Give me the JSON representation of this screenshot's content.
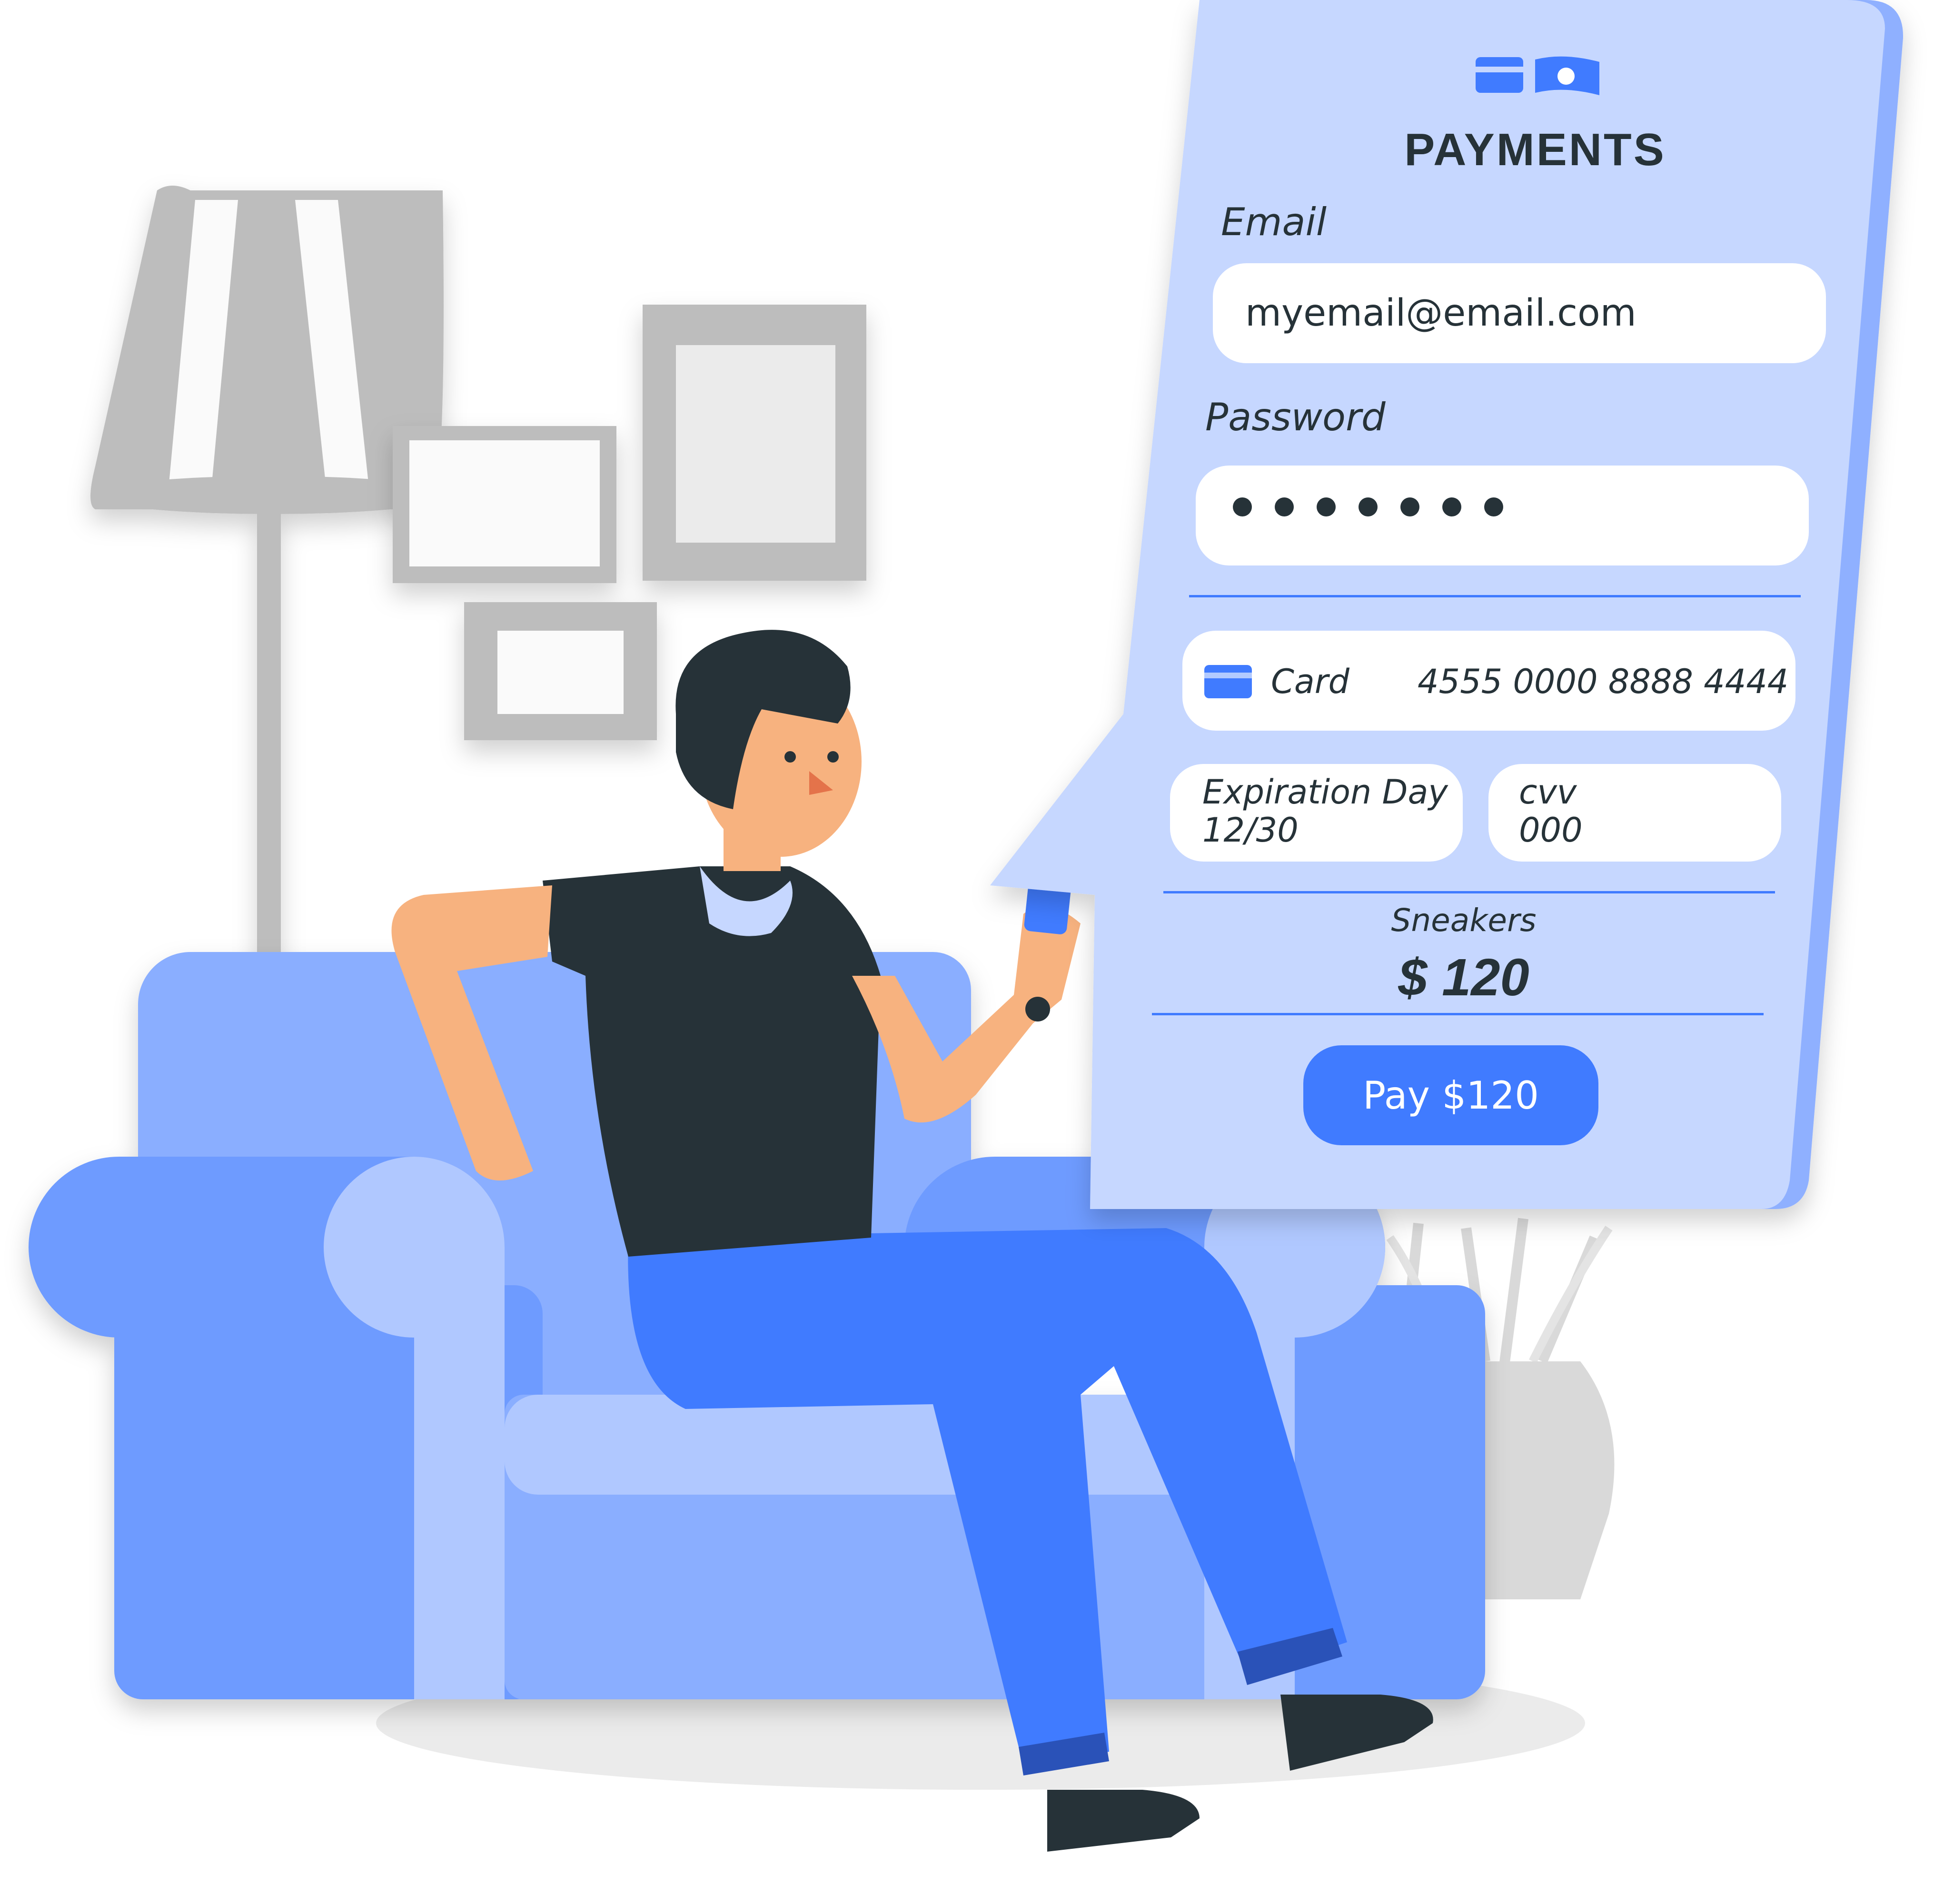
{
  "payments": {
    "title": "PAYMENTS",
    "icon": "card-and-cash-icon",
    "email": {
      "label": "Email",
      "value": "myemail@email.com"
    },
    "password": {
      "label": "Password",
      "masked_length": 7
    },
    "card": {
      "label": "Card",
      "icon": "credit-card-icon",
      "number": "4555 0000 8888 4444"
    },
    "expiration": {
      "label": "Expiration Day",
      "value": "12/30"
    },
    "cvv": {
      "label": "cvv",
      "value": "000"
    },
    "product": {
      "name": "Sneakers",
      "price": "$ 120"
    },
    "pay_button": {
      "label": "Pay $120"
    }
  },
  "colors": {
    "panel": "#c6d7ff",
    "panel_edge": "#8fb0ff",
    "accent": "#407bff",
    "dark": "#263238",
    "skin": "#f7b27f",
    "sofa_light": "#b0c8ff",
    "sofa_mid": "#8aaeff",
    "sofa_dark": "#6e9bff",
    "gray": "#bdbdbd",
    "gray_light": "#ebebeb"
  },
  "illustration": {
    "scene": "person-on-sofa-paying",
    "items": [
      "floor-lamp",
      "picture-frames",
      "sofa",
      "person",
      "smartphone",
      "vase-plant",
      "rug"
    ]
  }
}
